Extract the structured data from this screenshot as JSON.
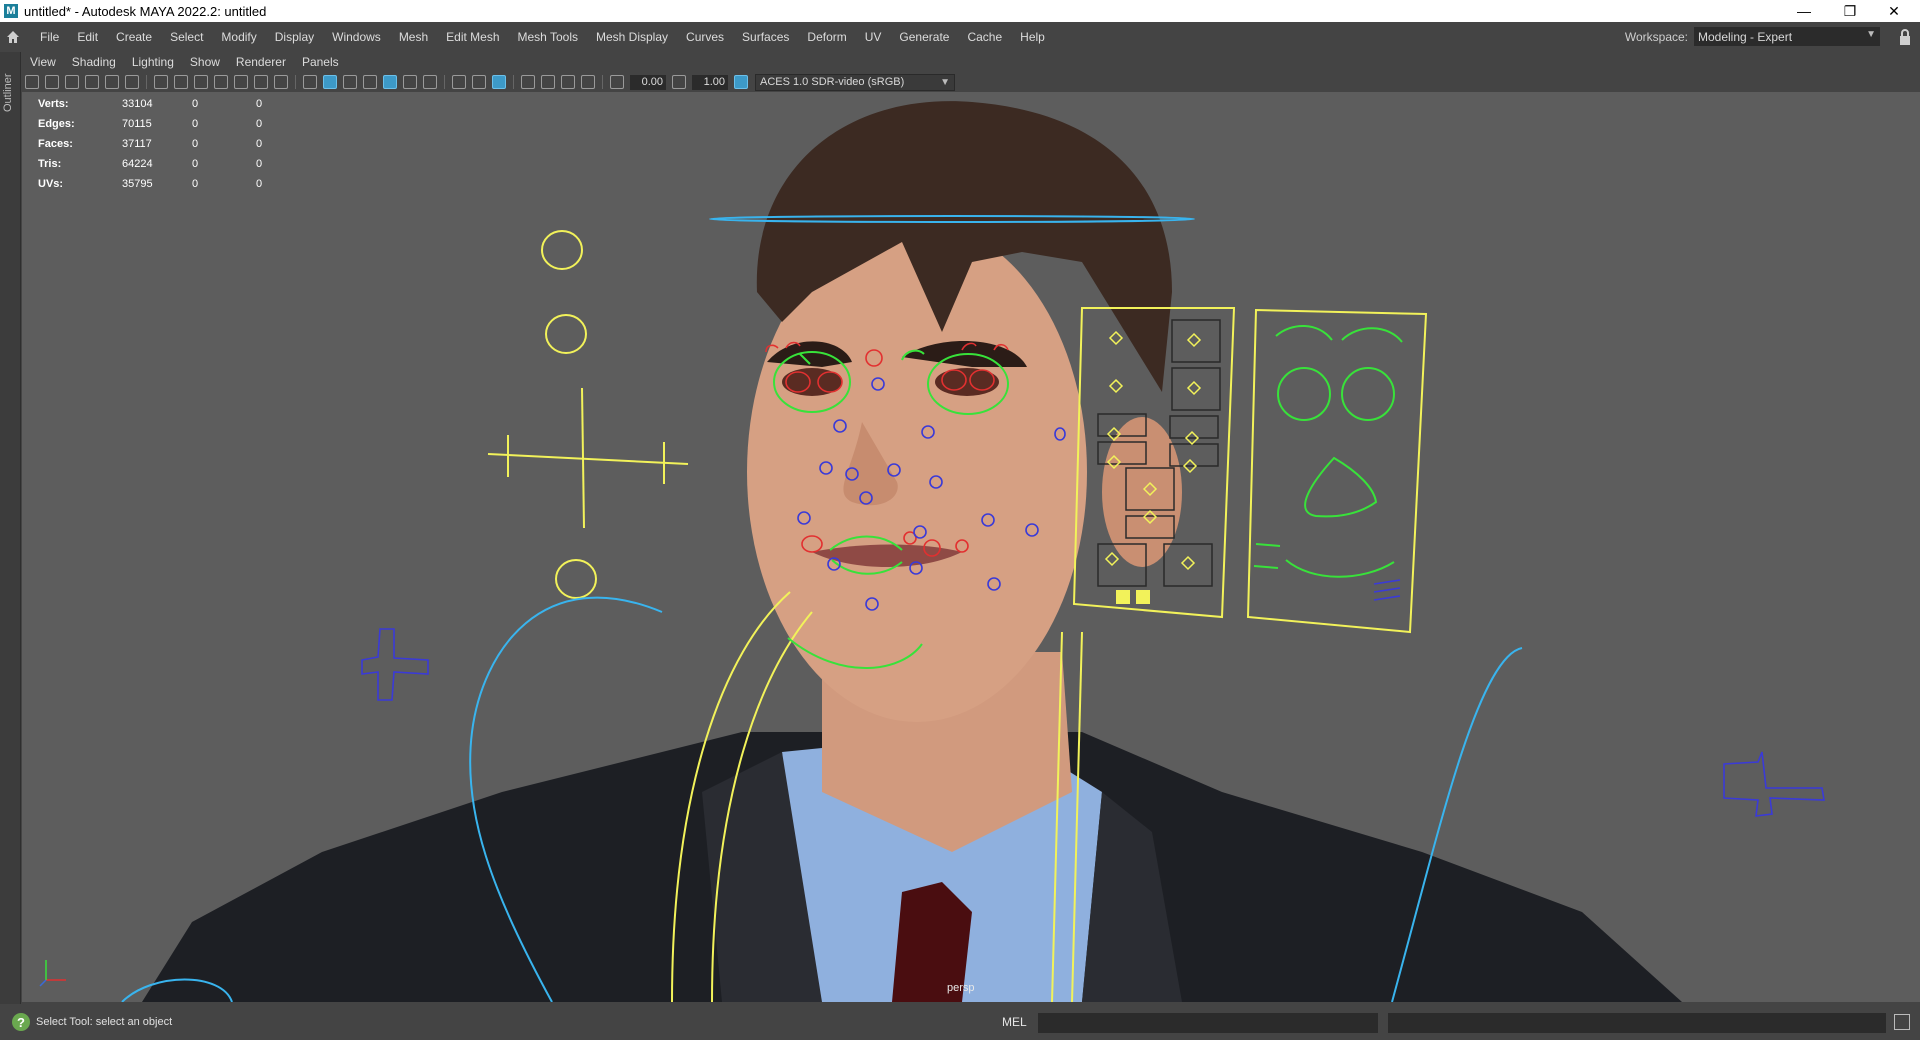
{
  "window": {
    "title": "untitled* - Autodesk MAYA 2022.2: untitled",
    "controls": [
      "minimize-icon",
      "restore-icon",
      "close-icon"
    ]
  },
  "menubar": {
    "items": [
      "File",
      "Edit",
      "Create",
      "Select",
      "Modify",
      "Display",
      "Windows",
      "Mesh",
      "Edit Mesh",
      "Mesh Tools",
      "Mesh Display",
      "Curves",
      "Surfaces",
      "Deform",
      "UV",
      "Generate",
      "Cache",
      "Help"
    ],
    "workspace_label": "Workspace:",
    "workspace_value": "Modeling - Expert"
  },
  "outliner": {
    "label": "Outliner"
  },
  "panel_menu": {
    "items": [
      "View",
      "Shading",
      "Lighting",
      "Show",
      "Renderer",
      "Panels"
    ]
  },
  "toolbar": {
    "exposure": "0.00",
    "gamma": "1.00",
    "color_space": "ACES 1.0 SDR-video (sRGB)"
  },
  "hud": {
    "rows": [
      {
        "label": "Verts:",
        "v1": "33104",
        "v2": "0",
        "v3": "0"
      },
      {
        "label": "Edges:",
        "v1": "70115",
        "v2": "0",
        "v3": "0"
      },
      {
        "label": "Faces:",
        "v1": "37117",
        "v2": "0",
        "v3": "0"
      },
      {
        "label": "Tris:",
        "v1": "64224",
        "v2": "0",
        "v3": "0"
      },
      {
        "label": "UVs:",
        "v1": "35795",
        "v2": "0",
        "v3": "0"
      }
    ]
  },
  "viewport": {
    "camera": "persp"
  },
  "status": {
    "help_text": "Select Tool: select an object",
    "command_lang": "MEL"
  },
  "colors": {
    "viewport_bg": "#5d5d5d",
    "ctrl_yellow": "#f2f25a",
    "ctrl_green": "#38e23a",
    "ctrl_red": "#e23030",
    "ctrl_blue": "#3a3ad8",
    "ctrl_cyan": "#39b4ee"
  }
}
